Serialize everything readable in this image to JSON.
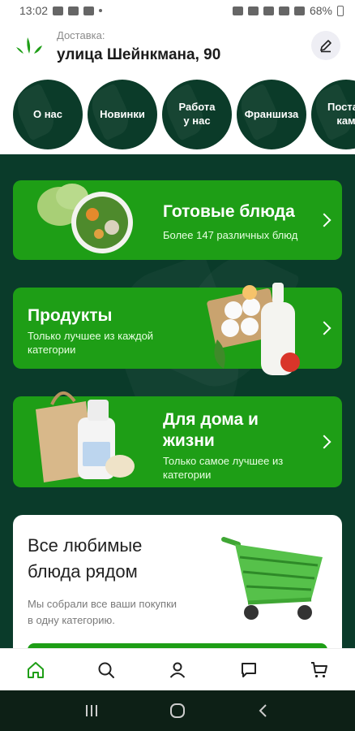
{
  "status_bar": {
    "time": "13:02",
    "battery": "68%"
  },
  "header": {
    "delivery_label": "Доставка:",
    "address": "улица Шейнкмана, 90"
  },
  "stories": [
    {
      "label": "О нас"
    },
    {
      "label": "Новинки"
    },
    {
      "label": "Работа\nу нас"
    },
    {
      "label": "Франшиза"
    },
    {
      "label": "Постав\nкам"
    }
  ],
  "categories": [
    {
      "title": "Готовые блюда",
      "subtitle": "Более 147 различных блюд"
    },
    {
      "title": "Продукты",
      "subtitle": "Только лучшее из каждой\nкатегории"
    },
    {
      "title": "Для дома и\nжизни",
      "subtitle": "Только самое лучшее из\nкатегории"
    }
  ],
  "promo": {
    "title": "Все любимые\nблюда рядом",
    "subtitle": "Мы собрали все ваши покупки\nв одну категорию."
  },
  "bottom_nav": [
    "home-icon",
    "search-icon",
    "profile-icon",
    "chat-icon",
    "cart-icon"
  ],
  "colors": {
    "brand_dark": "#0a3b2a",
    "brand_green": "#1e9e16",
    "icon_active": "#1e9e16"
  }
}
